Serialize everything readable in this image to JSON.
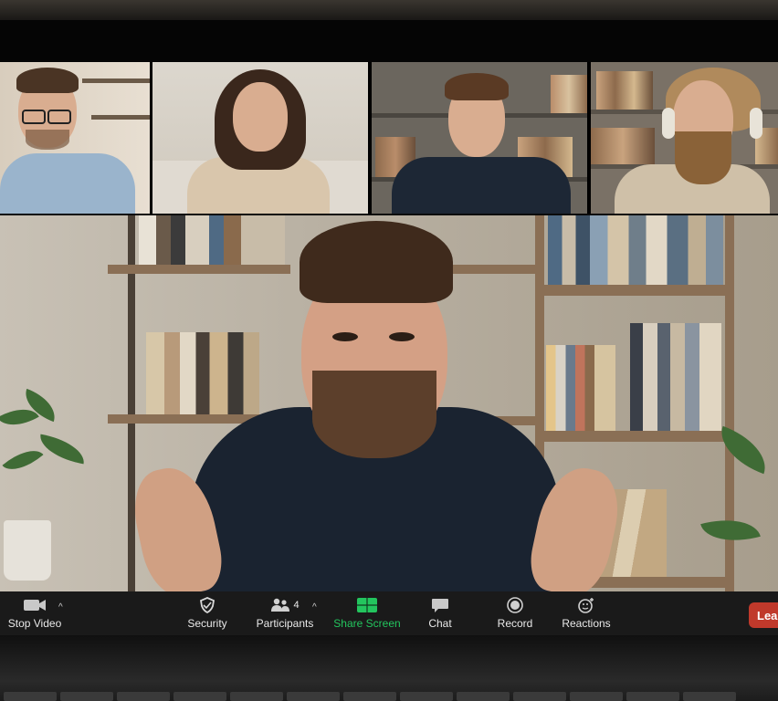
{
  "meeting": {
    "participant_count": "4"
  },
  "toolbar": {
    "stop_video": "Stop Video",
    "security": "Security",
    "participants": "Participants",
    "share_screen": "Share Screen",
    "chat": "Chat",
    "record": "Record",
    "reactions": "Reactions",
    "leave": "Lea"
  },
  "colors": {
    "toolbar_bg": "#1a1a1a",
    "share_accent": "#23c55e",
    "leave_red": "#c0392b"
  },
  "icons": {
    "stop_video": "video-camera-icon",
    "security": "shield-icon",
    "participants": "people-icon",
    "share_screen": "share-screen-icon",
    "chat": "chat-bubble-icon",
    "record": "record-icon",
    "reactions": "emoji-reaction-icon"
  }
}
